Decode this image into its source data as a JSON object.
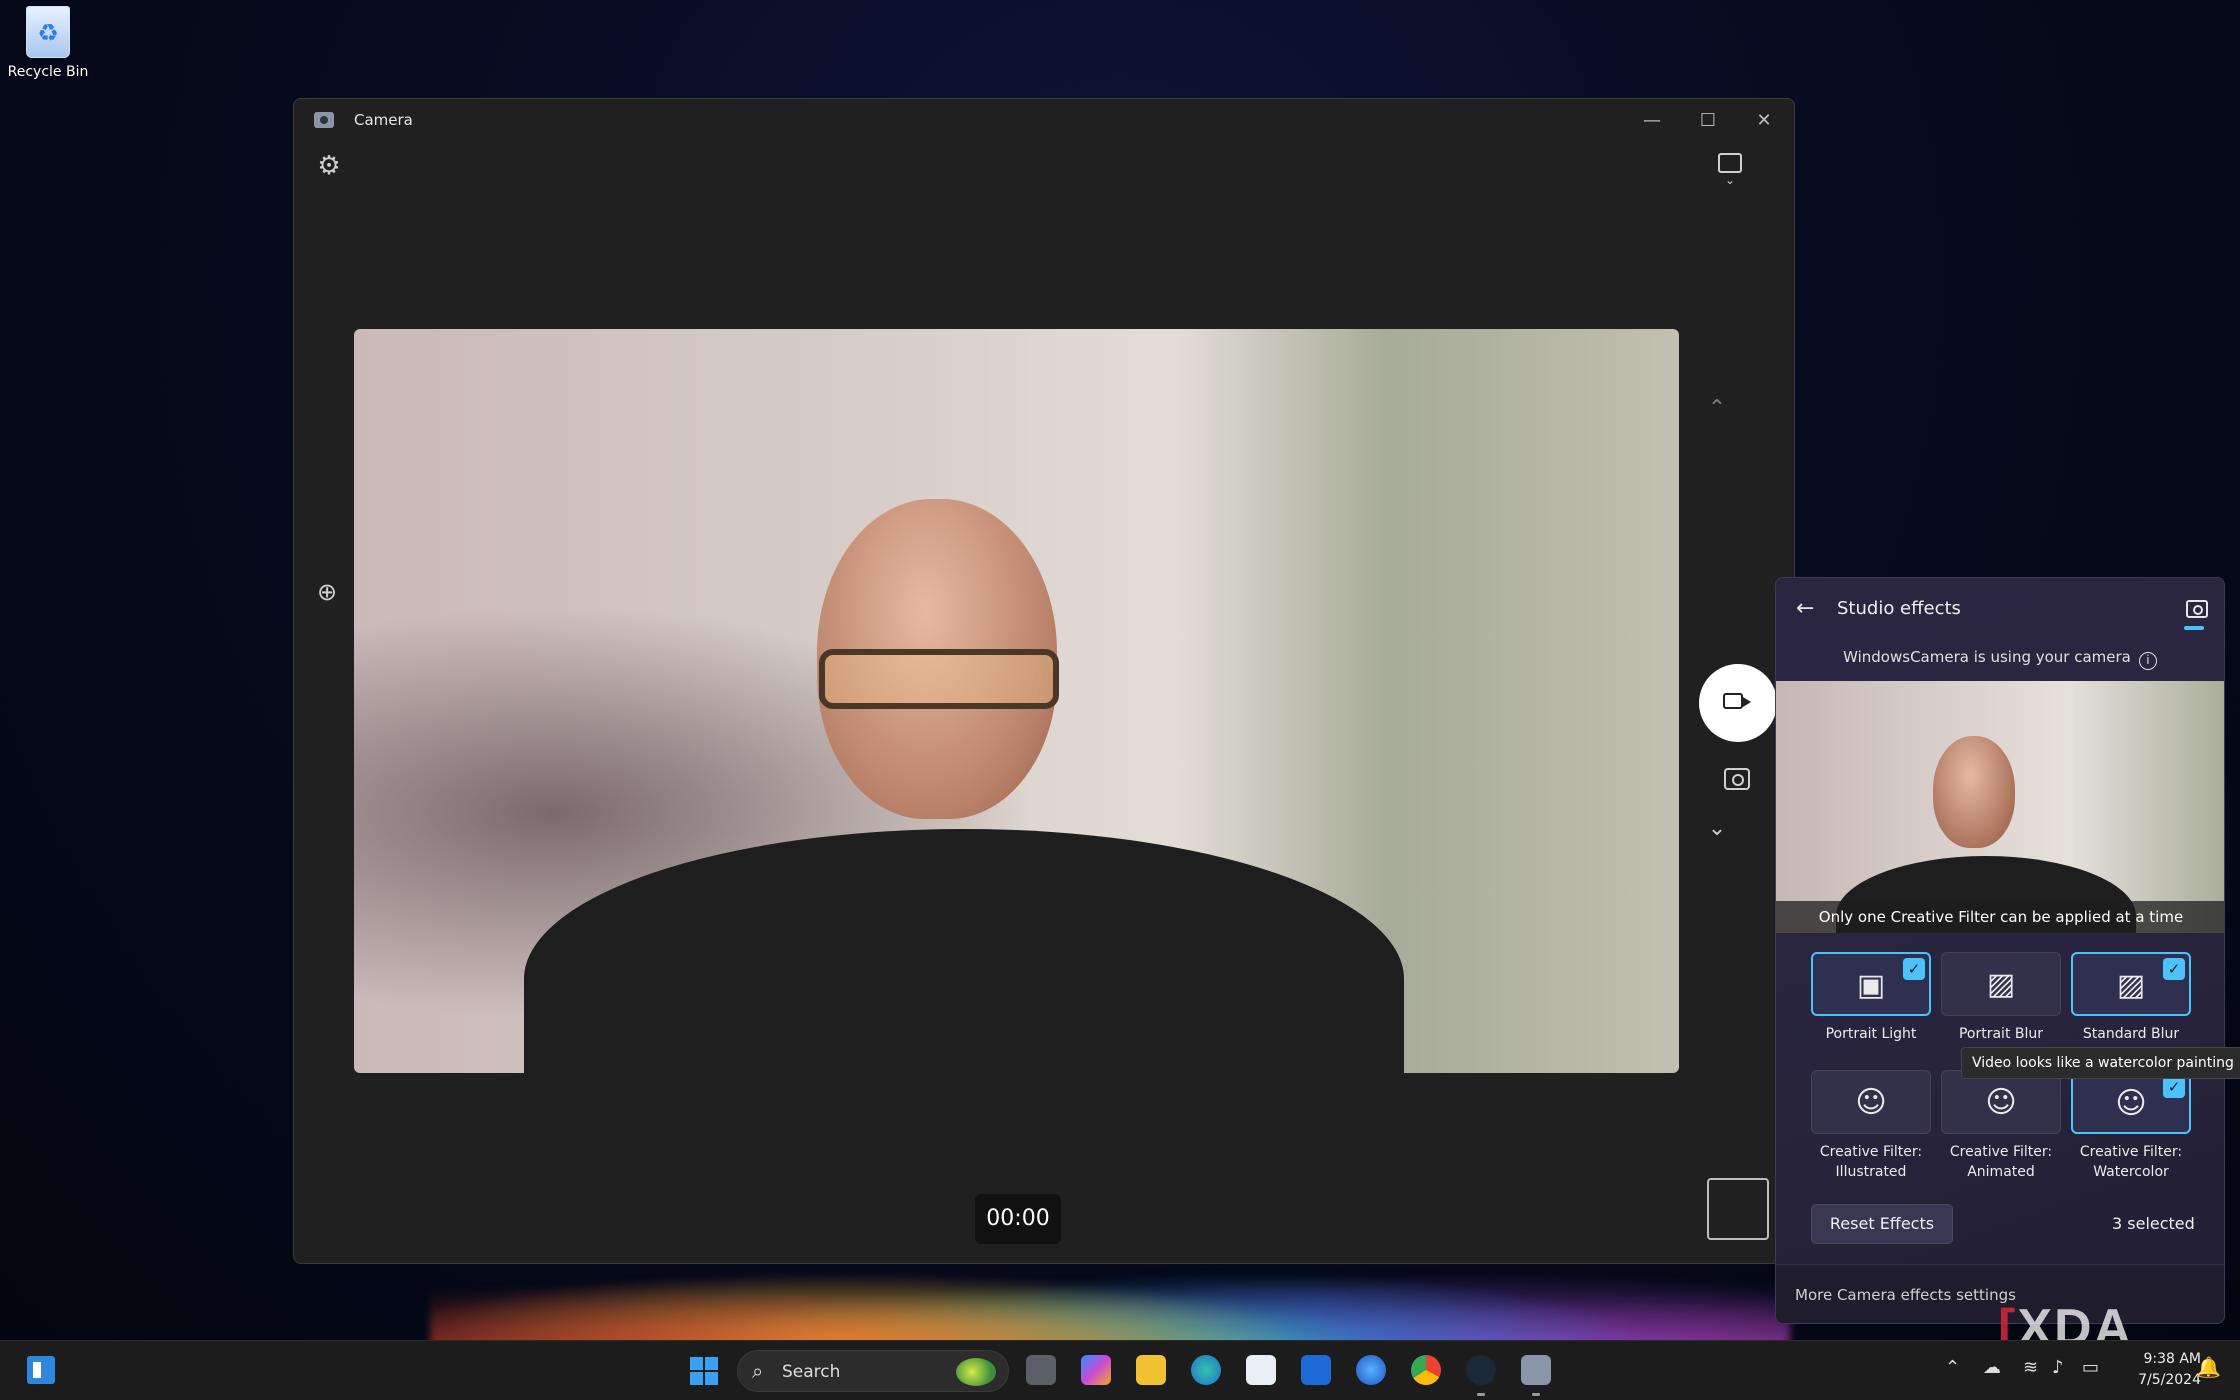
{
  "desktop": {
    "recycle_bin_label": "Recycle Bin"
  },
  "camera_window": {
    "title": "Camera",
    "controls": {
      "minimize": "—",
      "maximize": "☐",
      "close": "✕"
    },
    "timer": "00:00",
    "icons": [
      "settings-gear-icon",
      "gallery-icon",
      "zoom-icon",
      "chevron-up-icon",
      "video-mode-icon",
      "photo-mode-icon",
      "chevron-down-icon"
    ]
  },
  "studio_effects": {
    "title": "Studio effects",
    "status": "WindowsCamera is using your camera",
    "note": "Only one Creative Filter can be applied at a time",
    "effects": [
      {
        "label": "Portrait Light",
        "selected": true,
        "icon": "portrait-light-icon"
      },
      {
        "label": "Portrait Blur",
        "selected": false,
        "icon": "portrait-blur-icon"
      },
      {
        "label": "Standard Blur",
        "selected": true,
        "icon": "standard-blur-icon"
      },
      {
        "label": "Creative Filter:\nIllustrated",
        "selected": false,
        "icon": "creative-filter-icon"
      },
      {
        "label": "Creative Filter:\nAnimated",
        "selected": false,
        "icon": "creative-filter-animated-icon"
      },
      {
        "label": "Creative Filter:\nWatercolor",
        "selected": true,
        "icon": "creative-filter-watercolor-icon"
      }
    ],
    "tooltip": "Video looks like a watercolor painting",
    "reset_label": "Reset Effects",
    "selected_count": "3 selected",
    "more_settings": "More Camera effects settings",
    "accent": "#4cc2ff"
  },
  "watermark": {
    "brand_text": "XDA"
  },
  "taskbar": {
    "search_label": "Search",
    "apps": [
      "task-view",
      "copilot",
      "file-explorer",
      "edge",
      "microsoft-store",
      "myhp",
      "edge-beta",
      "chrome",
      "steam",
      "camera"
    ],
    "clock_time": "9:38 AM",
    "clock_date": "7/5/2024"
  }
}
